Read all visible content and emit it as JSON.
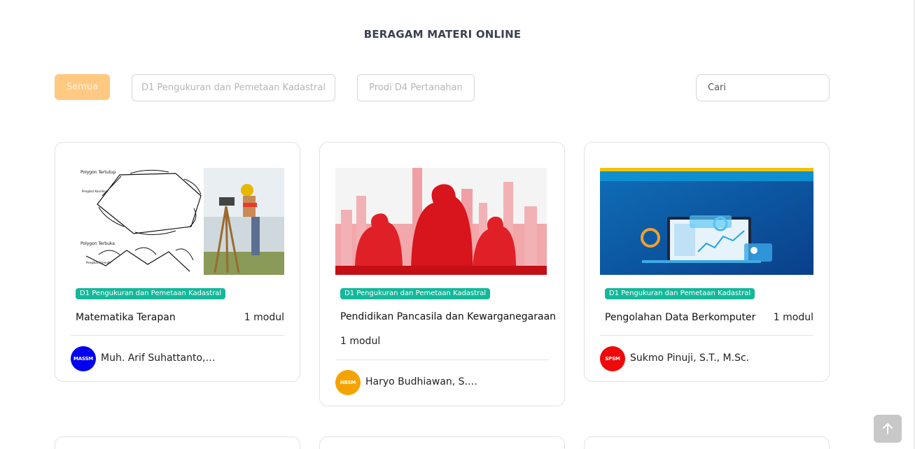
{
  "header": {
    "title": "BERAGAM MATERI ONLINE"
  },
  "filters": {
    "all_label": "Semua",
    "program_1": "D1 Pengukuran dan Pemetaan Kadastral",
    "program_2": "Prodi D4 Pertanahan",
    "search_placeholder": "Cari"
  },
  "courses": [
    {
      "badge": "D1 Pengukuran dan Pemetaan Kadastral",
      "title": "Matematika Terapan",
      "modules": "1 modul",
      "avatar_text": "MASSM",
      "avatar_color": "#0000ee",
      "instructor": "Muh. Arif Suhattanto, S....",
      "image_labels": {
        "top": "Polygon Tertutup",
        "top_sub": "Pengikat Koordinat",
        "bottom": "Polygon Terbuka",
        "bottom_sub": "Pengikat Azimuth"
      }
    },
    {
      "badge": "D1 Pengukuran dan Pemetaan Kadastral",
      "title": "Pendidikan Pancasila dan Kewarganegaraan",
      "modules": "1 modul",
      "avatar_text": "HBSM",
      "avatar_color": "#f5a300",
      "instructor": "Haryo Budhiawan, S.H., ..."
    },
    {
      "badge": "D1 Pengukuran dan Pemetaan Kadastral",
      "title": "Pengolahan Data Berkomputer",
      "modules": "1 modul",
      "avatar_text": "SPSM",
      "avatar_color": "#ee0a0a",
      "instructor": "Sukmo Pinuji, S.T., M.Sc."
    }
  ],
  "icons": {
    "scroll_top": "arrow-up-icon"
  },
  "colors": {
    "accent": "#ffc982",
    "badge": "#14b89a"
  }
}
